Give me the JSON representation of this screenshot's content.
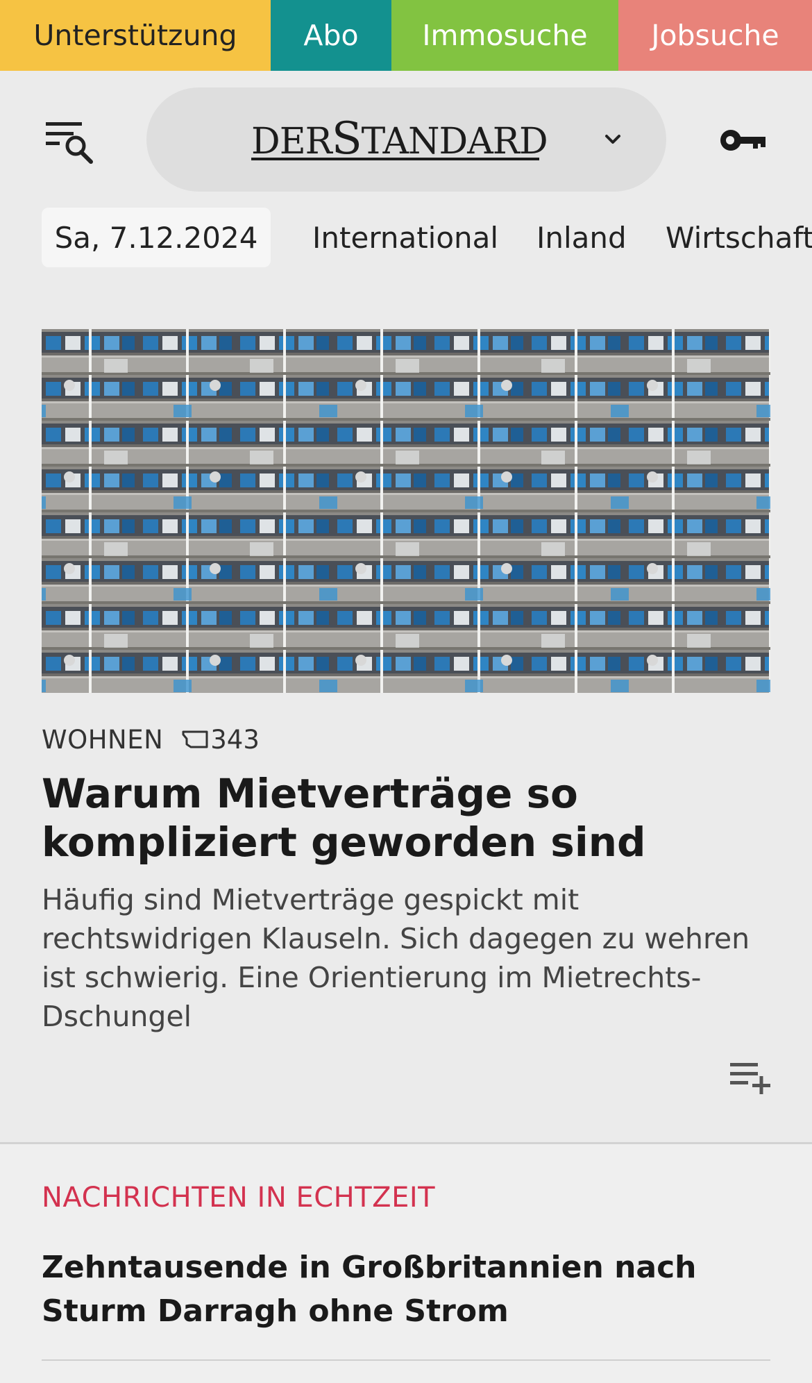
{
  "topbar": {
    "support_label": "Unterstützung",
    "abo_label": "Abo",
    "immo_label": "Immosuche",
    "jobs_label": "Jobsuche",
    "colors": {
      "support": "#f6c343",
      "abo": "#13918f",
      "immo": "#82c341",
      "jobs": "#e8837a"
    }
  },
  "header": {
    "menu_icon": "menu-search-icon",
    "logo": {
      "der": "DER",
      "s": "S",
      "tandard": "TANDARD"
    },
    "chevron_icon": "chevron-down-icon",
    "login_icon": "key-icon"
  },
  "nav": {
    "date": "Sa, 7.12.2024",
    "items": [
      "International",
      "Inland",
      "Wirtschaft"
    ]
  },
  "lead": {
    "section": "WOHNEN",
    "comment_count": "343",
    "comment_icon": "comment-icon",
    "headline": "Warum Mietverträge so kompliziert geworden sind",
    "teaser": "Häufig sind Mietverträge gespickt mit rechtswidrigen Klauseln. Sich dagegen zu wehren ist schwierig. Eine Orientierung im Mietrechts-Dschungel",
    "save_icon": "playlist-add-icon"
  },
  "live": {
    "label": "NACHRICHTEN IN ECHTZEIT",
    "headline": "Zehntausende in Großbritannien nach Sturm Dar­ragh ohne Strom",
    "accent_color": "#d3324f"
  }
}
